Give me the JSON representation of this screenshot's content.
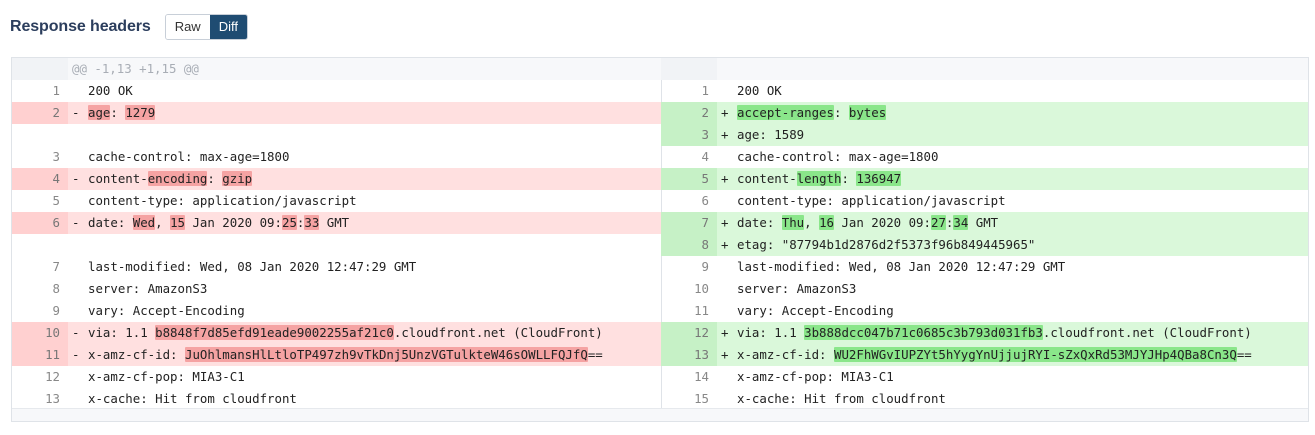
{
  "header": {
    "title": "Response headers",
    "raw_label": "Raw",
    "diff_label": "Diff"
  },
  "diff": {
    "hunk": "@@ -1,13 +1,15 @@",
    "left": [
      {
        "type": "ctx",
        "n": "1",
        "segs": [
          {
            "t": "200 OK"
          }
        ]
      },
      {
        "type": "del",
        "n": "2",
        "segs": [
          {
            "t": "age",
            "h": 1
          },
          {
            "t": ": "
          },
          {
            "t": "1279",
            "h": 1
          }
        ]
      },
      {
        "type": "empty"
      },
      {
        "type": "ctx",
        "n": "3",
        "segs": [
          {
            "t": "cache-control: max-age=1800"
          }
        ]
      },
      {
        "type": "del",
        "n": "4",
        "segs": [
          {
            "t": "content-"
          },
          {
            "t": "encoding",
            "h": 1
          },
          {
            "t": ": "
          },
          {
            "t": "gzip",
            "h": 1
          }
        ]
      },
      {
        "type": "ctx",
        "n": "5",
        "segs": [
          {
            "t": "content-type: application/javascript"
          }
        ]
      },
      {
        "type": "del",
        "n": "6",
        "segs": [
          {
            "t": "date: "
          },
          {
            "t": "Wed",
            "h": 1
          },
          {
            "t": ", "
          },
          {
            "t": "15",
            "h": 1
          },
          {
            "t": " Jan 2020 09:"
          },
          {
            "t": "25",
            "h": 1
          },
          {
            "t": ":"
          },
          {
            "t": "33",
            "h": 1
          },
          {
            "t": " GMT"
          }
        ]
      },
      {
        "type": "empty"
      },
      {
        "type": "ctx",
        "n": "7",
        "segs": [
          {
            "t": "last-modified: Wed, 08 Jan 2020 12:47:29 GMT"
          }
        ]
      },
      {
        "type": "ctx",
        "n": "8",
        "segs": [
          {
            "t": "server: AmazonS3"
          }
        ]
      },
      {
        "type": "ctx",
        "n": "9",
        "segs": [
          {
            "t": "vary: Accept-Encoding"
          }
        ]
      },
      {
        "type": "del",
        "n": "10",
        "segs": [
          {
            "t": "via: 1.1 "
          },
          {
            "t": "b8848f7d85efd91eade9002255af21c0",
            "h": 1
          },
          {
            "t": ".cloudfront.net (CloudFront)"
          }
        ]
      },
      {
        "type": "del",
        "n": "11",
        "segs": [
          {
            "t": "x-amz-cf-id: "
          },
          {
            "t": "JuOhlmansHlLtloTP497zh9vTkDnj5UnzVGTulkteW46sOWLLFQJfQ",
            "h": 1
          },
          {
            "t": "=="
          }
        ]
      },
      {
        "type": "ctx",
        "n": "12",
        "segs": [
          {
            "t": "x-amz-cf-pop: MIA3-C1"
          }
        ]
      },
      {
        "type": "ctx",
        "n": "13",
        "segs": [
          {
            "t": "x-cache: Hit from cloudfront"
          }
        ]
      }
    ],
    "right": [
      {
        "type": "ctx",
        "n": "1",
        "segs": [
          {
            "t": "200 OK"
          }
        ]
      },
      {
        "type": "add",
        "n": "2",
        "segs": [
          {
            "t": "accept-ranges",
            "h": 1
          },
          {
            "t": ": "
          },
          {
            "t": "bytes",
            "h": 1
          }
        ]
      },
      {
        "type": "add",
        "n": "3",
        "segs": [
          {
            "t": "age: 1589"
          }
        ]
      },
      {
        "type": "ctx",
        "n": "4",
        "segs": [
          {
            "t": "cache-control: max-age=1800"
          }
        ]
      },
      {
        "type": "add",
        "n": "5",
        "segs": [
          {
            "t": "content-"
          },
          {
            "t": "length",
            "h": 1
          },
          {
            "t": ": "
          },
          {
            "t": "136947",
            "h": 1
          }
        ]
      },
      {
        "type": "ctx",
        "n": "6",
        "segs": [
          {
            "t": "content-type: application/javascript"
          }
        ]
      },
      {
        "type": "add",
        "n": "7",
        "segs": [
          {
            "t": "date: "
          },
          {
            "t": "Thu",
            "h": 1
          },
          {
            "t": ", "
          },
          {
            "t": "16",
            "h": 1
          },
          {
            "t": " Jan 2020 09:"
          },
          {
            "t": "27",
            "h": 1
          },
          {
            "t": ":"
          },
          {
            "t": "34",
            "h": 1
          },
          {
            "t": " GMT"
          }
        ]
      },
      {
        "type": "add",
        "n": "8",
        "segs": [
          {
            "t": "etag: \"87794b1d2876d2f5373f96b849445965\""
          }
        ]
      },
      {
        "type": "ctx",
        "n": "9",
        "segs": [
          {
            "t": "last-modified: Wed, 08 Jan 2020 12:47:29 GMT"
          }
        ]
      },
      {
        "type": "ctx",
        "n": "10",
        "segs": [
          {
            "t": "server: AmazonS3"
          }
        ]
      },
      {
        "type": "ctx",
        "n": "11",
        "segs": [
          {
            "t": "vary: Accept-Encoding"
          }
        ]
      },
      {
        "type": "add",
        "n": "12",
        "segs": [
          {
            "t": "via: 1.1 "
          },
          {
            "t": "3b888dcc047b71c0685c3b793d031fb3",
            "h": 1
          },
          {
            "t": ".cloudfront.net (CloudFront)"
          }
        ]
      },
      {
        "type": "add",
        "n": "13",
        "segs": [
          {
            "t": "x-amz-cf-id: "
          },
          {
            "t": "WU2FhWGvIUPZYt5hYygYnUjjujRYI-sZxQxRd53MJYJHp4QBa8Cn3Q",
            "h": 1
          },
          {
            "t": "=="
          }
        ]
      },
      {
        "type": "ctx",
        "n": "14",
        "segs": [
          {
            "t": "x-amz-cf-pop: MIA3-C1"
          }
        ]
      },
      {
        "type": "ctx",
        "n": "15",
        "segs": [
          {
            "t": "x-cache: Hit from cloudfront"
          }
        ]
      }
    ]
  }
}
